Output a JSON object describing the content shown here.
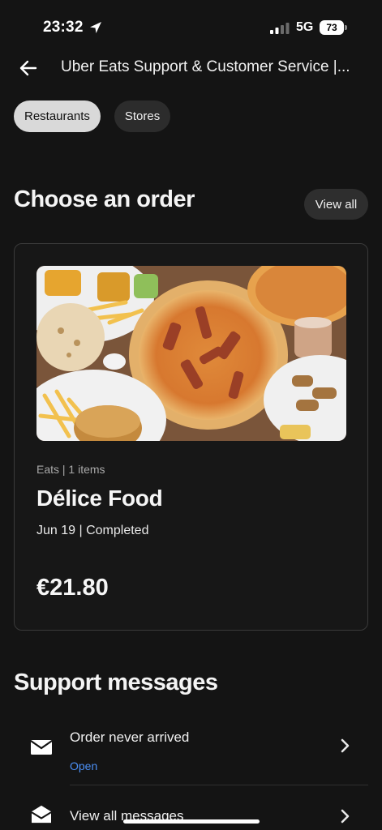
{
  "status_bar": {
    "time": "23:32",
    "network": "5G",
    "battery": "73",
    "icons": [
      "location-arrow-icon",
      "signal-bars-icon",
      "battery-icon"
    ]
  },
  "header": {
    "back_icon": "back-arrow-icon",
    "title": "Uber Eats Support & Customer Service |..."
  },
  "chips": [
    {
      "label": "Restaurants",
      "active": true
    },
    {
      "label": "Stores",
      "active": false
    }
  ],
  "orders_section": {
    "title": "Choose an order",
    "view_all_label": "View all"
  },
  "order_card": {
    "meta": "Eats | 1 items",
    "store": "Délice Food",
    "status": "Jun 19 | Completed",
    "price": "€21.80"
  },
  "support_section": {
    "title": "Support messages",
    "messages": [
      {
        "title": "Order never arrived",
        "status": "Open",
        "icon": "envelope-icon"
      },
      {
        "title": "View all messages",
        "icon": "envelope-open-icon"
      }
    ]
  },
  "colors": {
    "background": "#141414",
    "chip_active": "#d9d9d9",
    "chip_inactive": "#2c2c2c",
    "link_blue": "#4b8ff5"
  }
}
